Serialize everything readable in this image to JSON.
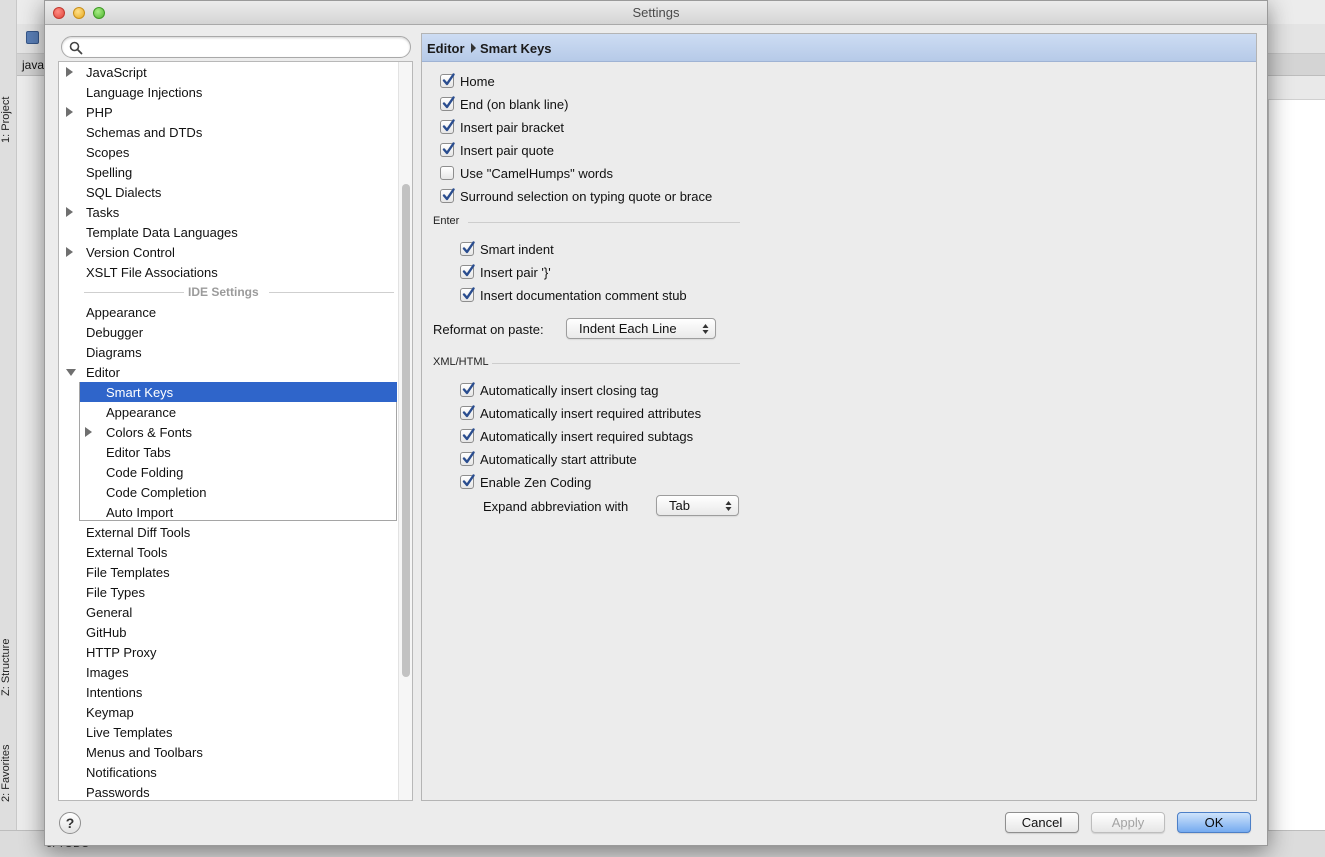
{
  "background": {
    "tool_windows": {
      "project": "1: Project",
      "structure": "Z: Structure",
      "favorites": "2: Favorites"
    },
    "tab_text": "java",
    "status_text": "6: TODO"
  },
  "window": {
    "title": "Settings"
  },
  "search": {
    "placeholder": "",
    "value": ""
  },
  "tree": {
    "items_top": [
      {
        "label": "JavaScript",
        "expandable": true
      },
      {
        "label": "Language Injections",
        "expandable": false
      },
      {
        "label": "PHP",
        "expandable": true
      },
      {
        "label": "Schemas and DTDs",
        "expandable": false
      },
      {
        "label": "Scopes",
        "expandable": false
      },
      {
        "label": "Spelling",
        "expandable": false
      },
      {
        "label": "SQL Dialects",
        "expandable": false
      },
      {
        "label": "Tasks",
        "expandable": true
      },
      {
        "label": "Template Data Languages",
        "expandable": false
      },
      {
        "label": "Version Control",
        "expandable": true
      },
      {
        "label": "XSLT File Associations",
        "expandable": false
      }
    ],
    "section_label": "IDE Settings",
    "items_ide": [
      {
        "label": "Appearance"
      },
      {
        "label": "Debugger"
      },
      {
        "label": "Diagrams"
      },
      {
        "label": "Editor",
        "expanded": true
      }
    ],
    "editor_children": [
      {
        "label": "Smart Keys",
        "selected": true
      },
      {
        "label": "Appearance"
      },
      {
        "label": "Colors & Fonts",
        "expandable": true
      },
      {
        "label": "Editor Tabs"
      },
      {
        "label": "Code Folding"
      },
      {
        "label": "Code Completion"
      },
      {
        "label": "Auto Import"
      }
    ],
    "items_after": [
      {
        "label": "External Diff Tools"
      },
      {
        "label": "External Tools"
      },
      {
        "label": "File Templates"
      },
      {
        "label": "File Types"
      },
      {
        "label": "General"
      },
      {
        "label": "GitHub"
      },
      {
        "label": "HTTP Proxy"
      },
      {
        "label": "Images"
      },
      {
        "label": "Intentions"
      },
      {
        "label": "Keymap"
      },
      {
        "label": "Live Templates"
      },
      {
        "label": "Menus and Toolbars"
      },
      {
        "label": "Notifications"
      },
      {
        "label": "Passwords"
      }
    ]
  },
  "panel": {
    "breadcrumb": {
      "parent": "Editor",
      "current": "Smart Keys"
    },
    "general_options": [
      {
        "label": "Home",
        "checked": true
      },
      {
        "label": "End (on blank line)",
        "checked": true
      },
      {
        "label": "Insert pair bracket",
        "checked": true
      },
      {
        "label": "Insert pair quote",
        "checked": true
      },
      {
        "label": "Use \"CamelHumps\" words",
        "checked": false
      },
      {
        "label": "Surround selection on typing quote or brace",
        "checked": true
      }
    ],
    "enter_group": {
      "title": "Enter",
      "options": [
        {
          "label": "Smart indent",
          "checked": true
        },
        {
          "label": "Insert pair '}'",
          "checked": true
        },
        {
          "label": "Insert documentation comment stub",
          "checked": true
        }
      ]
    },
    "reformat": {
      "label": "Reformat on paste:",
      "value": "Indent Each Line"
    },
    "xml_group": {
      "title": "XML/HTML",
      "options": [
        {
          "label": "Automatically insert closing tag",
          "checked": true
        },
        {
          "label": "Automatically insert required attributes",
          "checked": true
        },
        {
          "label": "Automatically insert required subtags",
          "checked": true
        },
        {
          "label": "Automatically start attribute",
          "checked": true
        },
        {
          "label": "Enable Zen Coding",
          "checked": true
        }
      ]
    },
    "expand_abbreviation": {
      "label": "Expand abbreviation with",
      "value": "Tab"
    }
  },
  "footer": {
    "help_label": "?",
    "cancel_label": "Cancel",
    "apply_label": "Apply",
    "ok_label": "OK"
  },
  "colors": {
    "selection": "#2f65ca",
    "header_gradient_top": "#cddcf3",
    "checkbox_check": "#2a4d8f"
  }
}
